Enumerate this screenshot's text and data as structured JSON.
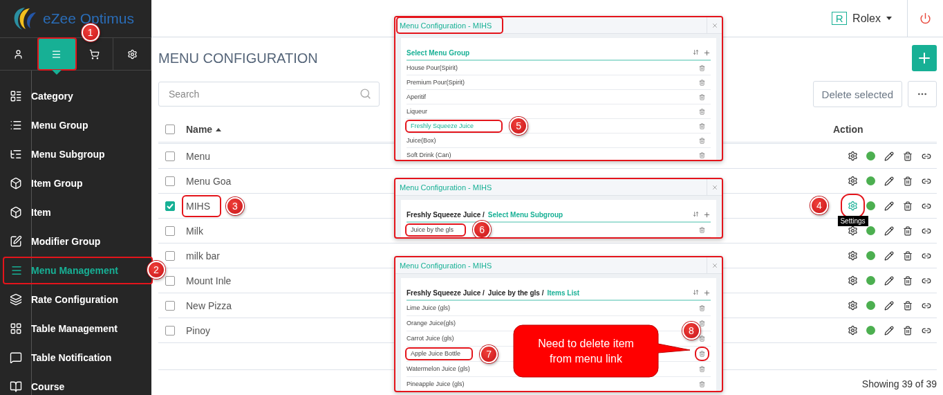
{
  "sidebar": {
    "brand": "eZee Optimus",
    "tabs": [
      {
        "selected": false
      },
      {
        "selected": true,
        "highlighted": true,
        "annotation": "1"
      },
      {
        "selected": false
      },
      {
        "selected": false
      }
    ],
    "items": [
      {
        "label": "Category",
        "selected": false
      },
      {
        "label": "Menu Group",
        "selected": false
      },
      {
        "label": "Menu Subgroup",
        "selected": false
      },
      {
        "label": "Item Group",
        "selected": false
      },
      {
        "label": "Item",
        "selected": false
      },
      {
        "label": "Modifier Group",
        "selected": false
      },
      {
        "label": "Menu Management",
        "selected": true,
        "highlighted": true,
        "annotation": "2"
      },
      {
        "label": "Rate Configuration",
        "selected": false
      },
      {
        "label": "Table Management",
        "selected": false
      },
      {
        "label": "Table Notification",
        "selected": false
      },
      {
        "label": "Course",
        "selected": false
      }
    ]
  },
  "header": {
    "user_initial": "R",
    "user_name": "Rolex"
  },
  "page": {
    "title": "MENU CONFIGURATION",
    "search": {
      "placeholder": "Search"
    },
    "delete_button": "Delete selected"
  },
  "table": {
    "columns": [
      "Name",
      "Action"
    ],
    "select_all": {
      "checked": false
    },
    "rows": [
      {
        "name": "Menu",
        "checked": false,
        "active": true
      },
      {
        "name": "Menu Goa",
        "checked": false,
        "active": true
      },
      {
        "name": "MIHS",
        "checked": true,
        "active": true,
        "highlighted": true,
        "annotation": "3",
        "settings_highlighted": true,
        "settings_annotation": "4",
        "tooltip": "Settings"
      },
      {
        "name": "Milk",
        "checked": false,
        "active": true
      },
      {
        "name": "milk bar",
        "checked": false,
        "active": true
      },
      {
        "name": "Mount Inle",
        "checked": false,
        "active": true
      },
      {
        "name": "New Pizza",
        "checked": false,
        "active": true
      },
      {
        "name": "Pinoy",
        "checked": false,
        "active": true
      }
    ],
    "footer": "Showing 39 of 39"
  },
  "dialogs": [
    {
      "title": "Menu Configuration - MIHS",
      "title_highlighted": true,
      "heading": "Select Menu Group",
      "items": [
        {
          "label": "House Pour(Spirit)",
          "selected": false
        },
        {
          "label": "Premium Pour(Spirit)",
          "selected": false
        },
        {
          "label": "Aperitif",
          "selected": false
        },
        {
          "label": "Liqueur",
          "selected": false
        },
        {
          "label": "Freshly Squeeze Juice",
          "selected": true,
          "highlighted": true,
          "annotation": "5"
        },
        {
          "label": "Juice(Box)",
          "selected": false
        },
        {
          "label": "Soft Drink (Can)",
          "selected": false
        }
      ]
    },
    {
      "title": "Menu Configuration - MIHS",
      "crumbs": [
        "Freshly Squeeze Juice /"
      ],
      "heading": "Select Menu Subgroup",
      "items": [
        {
          "label": "Juice by the gls",
          "selected": false,
          "highlighted": true,
          "annotation": "6"
        }
      ]
    },
    {
      "title": "Menu Configuration - MIHS",
      "crumbs": [
        "Freshly Squeeze Juice /",
        "Juice by the gls /"
      ],
      "heading": "Items List",
      "items": [
        {
          "label": "Lime Juice (gls)",
          "selected": false
        },
        {
          "label": "Orange Juice(gls)",
          "selected": false
        },
        {
          "label": "Carrot Juice (gls)",
          "selected": false
        },
        {
          "label": "Apple Juice Bottle",
          "selected": false,
          "highlighted": true,
          "annotation": "7",
          "delete_highlighted": true,
          "delete_annotation": "8",
          "delete_callout": "Need to delete item from menu link"
        },
        {
          "label": "Watermelon Juice (gls)",
          "selected": false
        },
        {
          "label": "Pineapple Juice (gls)",
          "selected": false
        }
      ]
    }
  ]
}
